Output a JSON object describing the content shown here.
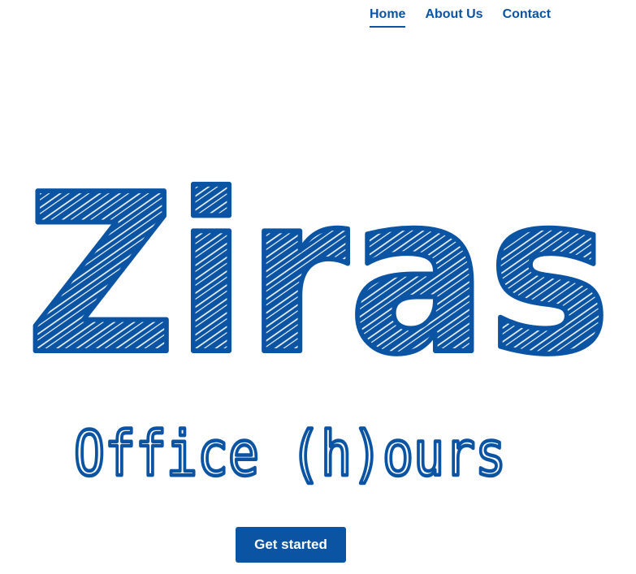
{
  "nav": {
    "items": [
      {
        "label": "Home",
        "active": true
      },
      {
        "label": "About Us",
        "active": false
      },
      {
        "label": "Contact",
        "active": false
      }
    ]
  },
  "hero": {
    "brand": "Ziras",
    "tagline": "Office (h)ours"
  },
  "cta": {
    "label": "Get started"
  },
  "colors": {
    "brand": "#0a54a3",
    "background": "#ffffff"
  }
}
